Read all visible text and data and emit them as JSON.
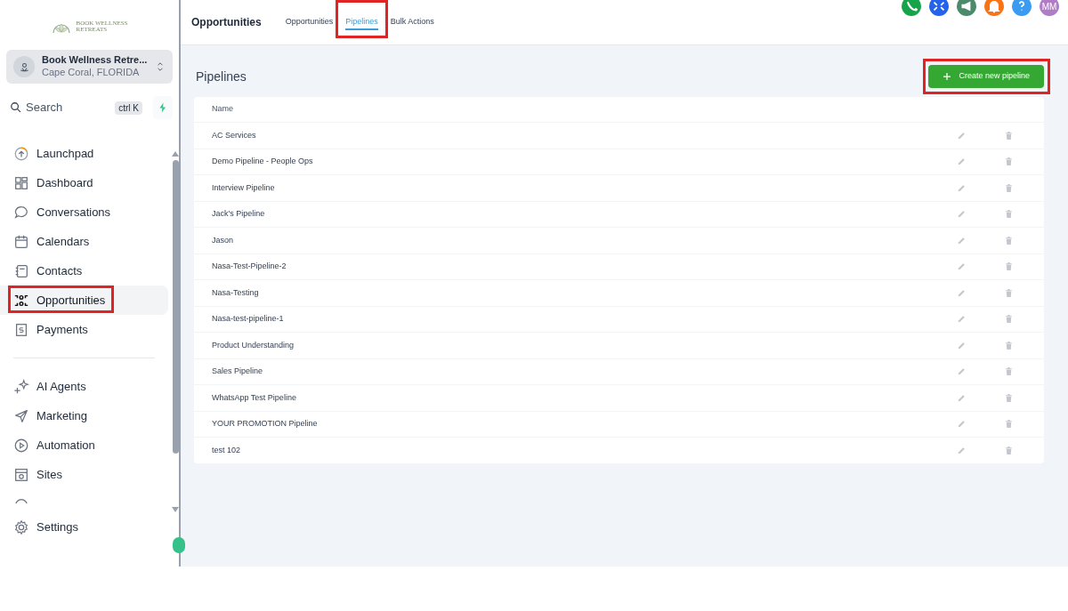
{
  "sidebar": {
    "logo": {
      "line_1": "BOOK WELLNESS",
      "line_2": "RETREATS"
    },
    "account": {
      "name": "Book Wellness Retre...",
      "location": "Cape Coral, FLORIDA"
    },
    "search": {
      "placeholder": "Search",
      "shortcut": "ctrl K"
    },
    "items": [
      {
        "label": "Launchpad",
        "selected": false,
        "highlighted": false
      },
      {
        "label": "Dashboard",
        "selected": false,
        "highlighted": false
      },
      {
        "label": "Conversations",
        "selected": false,
        "highlighted": false
      },
      {
        "label": "Calendars",
        "selected": false,
        "highlighted": false
      },
      {
        "label": "Contacts",
        "selected": false,
        "highlighted": false
      },
      {
        "label": "Opportunities",
        "selected": true,
        "highlighted": true
      },
      {
        "label": "Payments",
        "selected": false,
        "highlighted": false
      }
    ],
    "items_2": [
      {
        "label": "AI Agents"
      },
      {
        "label": "Marketing"
      },
      {
        "label": "Automation"
      },
      {
        "label": "Sites"
      }
    ],
    "settings": "Settings"
  },
  "header": {
    "title": "Opportunities",
    "tabs": [
      {
        "label": "Opportunities",
        "selected": false,
        "highlighted": false
      },
      {
        "label": "Pipelines",
        "selected": true,
        "highlighted": true
      },
      {
        "label": "Bulk Actions",
        "selected": false,
        "highlighted": false
      }
    ],
    "avatar": "MM"
  },
  "page": {
    "title": "Pipelines",
    "create_button": {
      "label": "Create new pipeline",
      "highlighted": true
    },
    "table": {
      "columns": [
        "Name"
      ],
      "rows": [
        "AC Services",
        "Demo Pipeline - People Ops",
        "Interview Pipeline",
        "Jack's Pipeline",
        "Jason",
        "Nasa-Test-Pipeline-2",
        "Nasa-Testing",
        "Nasa-test-pipeline-1",
        "Product Understanding",
        "Sales Pipeline",
        "WhatsApp Test Pipeline",
        "YOUR PROMOTION Pipeline",
        "test 102"
      ]
    }
  }
}
